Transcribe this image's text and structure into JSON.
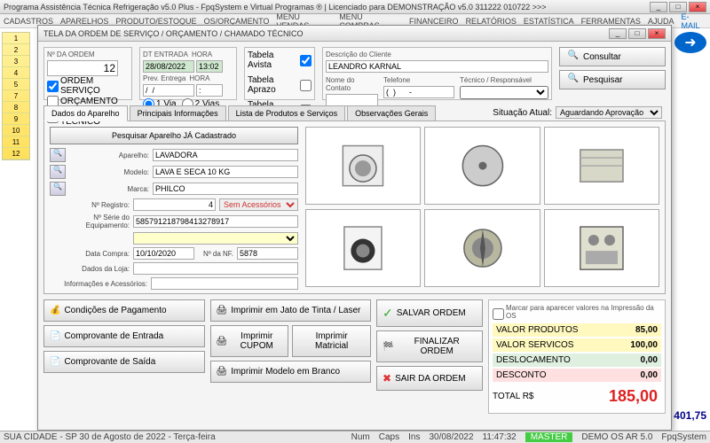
{
  "window": {
    "title": "Programa Assistência Técnica Refrigeração v5.0 Plus - FpqSystem e Virtual Programas ® | Licenciado para  DEMONSTRAÇÃO v5.0 311222 010722 >>>"
  },
  "menu": {
    "items": [
      "CADASTROS",
      "APARELHOS",
      "PRODUTO/ESTOQUE",
      "OS/ORÇAMENTO",
      "MENU VENDAS",
      "MENU COMPRAS",
      "FINANCEIRO",
      "RELATÓRIOS",
      "ESTATÍSTICA",
      "FERRAMENTAS",
      "AJUDA"
    ],
    "email": "E-MAIL"
  },
  "bg": {
    "ordem_label": "ORDEM",
    "left_nums": [
      "1",
      "2",
      "3",
      "4",
      "5",
      "7",
      "8",
      "9",
      "10",
      "11",
      "12"
    ],
    "arrow": "➜",
    "val": "401,75"
  },
  "modal": {
    "title": "TELA DA ORDEM DE SERVIÇO / ORÇAMENTO / CHAMADO TÉCNICO",
    "ordem": {
      "label": "Nº DA ORDEM",
      "value": "12"
    },
    "tipo": {
      "os": "ORDEM SERVIÇO",
      "orc": "ORÇAMENTO",
      "ch": "CHAMADO TÉCNICO"
    },
    "entrada": {
      "dt_label": "DT ENTRADA",
      "hora_label": "HORA",
      "dt": "28/08/2022",
      "hora": "13:02",
      "prev_label": "Prev. Entrega",
      "prev_hora": "HORA",
      "prev_dt": "/  /",
      "prev_h": ":",
      "via1": "1 Via",
      "via2": "2 Vias"
    },
    "tabela": {
      "avista": "Tabela Avista",
      "aprazo": "Tabela Aprazo",
      "atacado": "Tabela Atacado"
    },
    "cliente": {
      "desc_label": "Descrição do Cliente",
      "nome": "LEANDRO KARNAL",
      "contato_label": "Nome do Contato",
      "contato": "",
      "tel_label": "Telefone",
      "tel": "(  )      -",
      "tec_label": "Técnico / Responsável",
      "tec": ""
    },
    "btns": {
      "consultar": "Consultar",
      "pesquisar": "Pesquisar"
    },
    "tabs": {
      "t1": "Dados do Aparelho",
      "t2": "Principais Informações",
      "t3": "Lista de Produtos e Serviços",
      "t4": "Observações Gerais"
    },
    "situacao": {
      "label": "Situação Atual:",
      "value": "Aguardando Aprovação"
    },
    "aparelho": {
      "pesq_btn": "Pesquisar Aparelho JÁ Cadastrado",
      "ap_label": "Aparelho:",
      "ap": "LAVADORA",
      "mod_label": "Modelo:",
      "mod": "LAVA E SECA 10 KG",
      "marca_label": "Marca:",
      "marca": "PHILCO",
      "reg_label": "Nº Registro:",
      "reg": "4",
      "acess": "Sem Acessórios",
      "serie_label": "Nº Série do Equipamento:",
      "serie": "585791218798413278917",
      "serie2": "",
      "compra_label": "Data Compra:",
      "compra": "10/10/2020",
      "nf_label": "Nº da NF.",
      "nf": "5878",
      "loja_label": "Dados da Loja:",
      "loja": "",
      "info_label": "Informações e Acessórios:",
      "info": ""
    },
    "bottom": {
      "cond": "Condições de Pagamento",
      "comp_ent": "Comprovante de Entrada",
      "comp_sai": "Comprovante de Saída",
      "imp_laser": "Imprimir em Jato de Tinta / Laser",
      "imp_cupom": "Imprimir CUPOM",
      "imp_mat": "Imprimir Matricial",
      "imp_branco": "Imprimir Modelo em Branco",
      "salvar": "SALVAR ORDEM",
      "finalizar": "FINALIZAR ORDEM",
      "sair": "SAIR DA ORDEM"
    },
    "totals": {
      "mark": "Marcar para aparecer valores na Impressão da OS",
      "prod_l": "VALOR PRODUTOS",
      "prod_v": "85,00",
      "serv_l": "VALOR SERVICOS",
      "serv_v": "100,00",
      "desl_l": "DESLOCAMENTO",
      "desl_v": "0,00",
      "desc_l": "DESCONTO",
      "desc_v": "0,00",
      "tot_l": "TOTAL R$",
      "tot_v": "185,00"
    }
  },
  "status": {
    "loc": "SUA CIDADE - SP 30 de Agosto de 2022 - Terça-feira",
    "num": "Num",
    "caps": "Caps",
    "ins": "Ins",
    "date": "30/08/2022",
    "time": "11:47:32",
    "master": "MASTER",
    "demo": "DEMO OS AR 5.0",
    "fpq": "FpqSystem"
  }
}
